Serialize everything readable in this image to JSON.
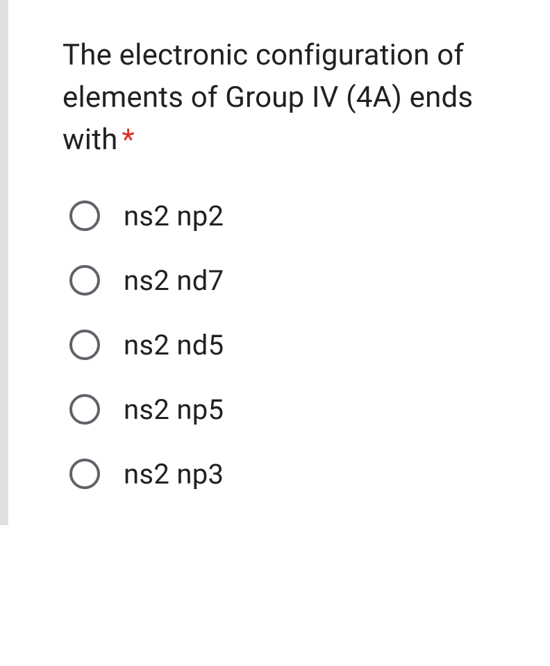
{
  "question": {
    "text": "The electronic configuration of elements of Group IV (4A) ends with",
    "required_mark": "*"
  },
  "options": [
    {
      "label": "ns2 np2"
    },
    {
      "label": "ns2 nd7"
    },
    {
      "label": "ns2 nd5"
    },
    {
      "label": "ns2 np5"
    },
    {
      "label": "ns2 np3"
    }
  ]
}
